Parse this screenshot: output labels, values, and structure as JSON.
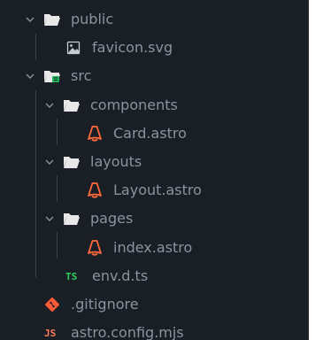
{
  "tree": {
    "public": {
      "label": "public",
      "children": {
        "favicon": {
          "label": "favicon.svg"
        }
      }
    },
    "src": {
      "label": "src",
      "children": {
        "components": {
          "label": "components",
          "card": {
            "label": "Card.astro"
          }
        },
        "layouts": {
          "label": "layouts",
          "layout": {
            "label": "Layout.astro"
          }
        },
        "pages": {
          "label": "pages",
          "index": {
            "label": "index.astro"
          }
        },
        "env": {
          "label": "env.d.ts"
        }
      }
    },
    "gitignore": {
      "label": ".gitignore"
    },
    "astro_config": {
      "label": "astro.config.mjs"
    }
  },
  "colors": {
    "background": "#1a1f26",
    "text": "#8a93a0",
    "folder": "#e8e8e8",
    "astro": "#ff6a3d",
    "ts": "#2fd05b",
    "git": "#ff5a36",
    "js": "#ff7a59",
    "src_badge": "#23b35b"
  }
}
